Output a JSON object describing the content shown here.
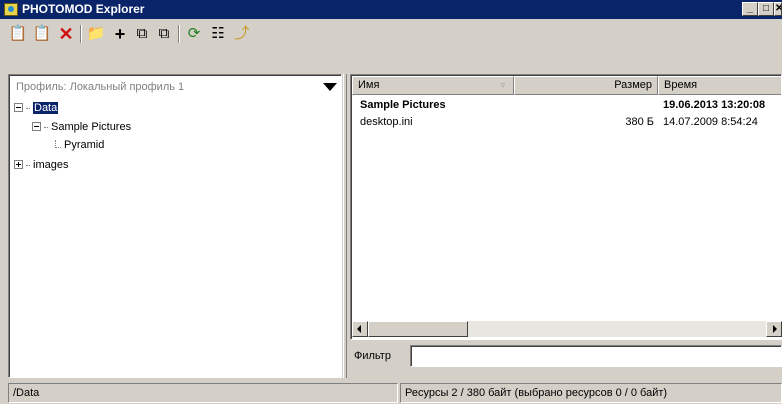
{
  "window": {
    "title": "PHOTOMOD Explorer",
    "minimize": "_",
    "maximize": "□",
    "close": "✕"
  },
  "toolbar": {
    "buttons": [
      {
        "name": "paste-icon",
        "glyph": "📋"
      },
      {
        "name": "paste-special-icon",
        "glyph": "📋"
      },
      {
        "name": "delete-icon",
        "glyph": "✕"
      },
      {
        "name": "new-folder-icon",
        "glyph": "📁"
      },
      {
        "name": "add-icon",
        "glyph": "+"
      },
      {
        "name": "copy-icon",
        "glyph": "⧉"
      },
      {
        "name": "copy-to-icon",
        "glyph": "⧉"
      },
      {
        "name": "refresh-icon",
        "glyph": "⟳"
      },
      {
        "name": "tree-view-icon",
        "glyph": "☷"
      },
      {
        "name": "folder-up-icon",
        "glyph": "⤴"
      }
    ]
  },
  "left": {
    "profile_label": "Профиль: Локальный профиль 1",
    "tree": [
      {
        "label": "Data",
        "level": 0,
        "expander": "minus",
        "selected": true
      },
      {
        "label": "Sample Pictures",
        "level": 1,
        "expander": "minus",
        "selected": false
      },
      {
        "label": "Pyramid",
        "level": 2,
        "expander": "none",
        "selected": false
      },
      {
        "label": "images",
        "level": 0,
        "expander": "plus",
        "selected": false
      }
    ]
  },
  "list": {
    "columns": [
      "Имя",
      "Размер",
      "Время"
    ],
    "rows": [
      {
        "name": "Sample Pictures",
        "size": "",
        "time": "19.06.2013 13:20:08",
        "bold": true
      },
      {
        "name": "desktop.ini",
        "size": "380 Б",
        "time": "14.07.2009 8:54:24",
        "bold": false
      }
    ]
  },
  "filter": {
    "label": "Фильтр",
    "value": ""
  },
  "status": {
    "path": "/Data",
    "resources": "Ресурсы 2 / 380 байт (выбрано ресурсов 0 / 0 байт)"
  }
}
